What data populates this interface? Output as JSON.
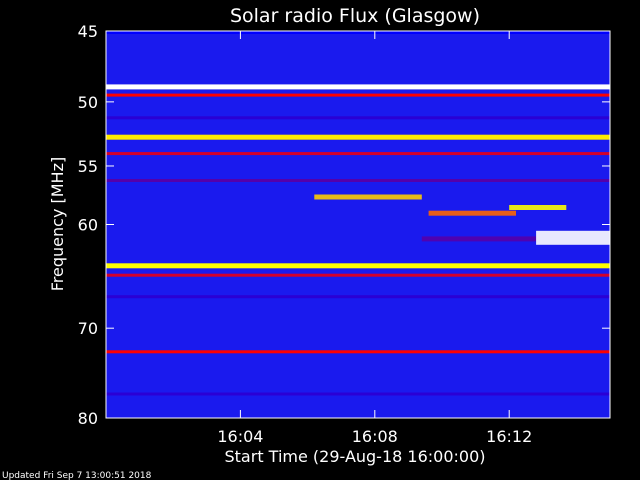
{
  "chart_data": {
    "type": "heatmap",
    "title": "Solar radio Flux (Glasgow)",
    "ylabel": "Frequency [MHz]",
    "xlabel": "Start Time (29-Aug-18 16:00:00)",
    "footer": "Updated Fri Sep  7 13:00:51 2018",
    "x_unit": "minutes after 16:00",
    "xlim": [
      0,
      15
    ],
    "ylim": [
      45,
      80
    ],
    "y_scale": "log",
    "x_ticks": [
      {
        "value": 4,
        "label": "16:04"
      },
      {
        "value": 8,
        "label": "16:08"
      },
      {
        "value": 12,
        "label": "16:12"
      }
    ],
    "y_ticks": [
      {
        "value": 45,
        "label": "45"
      },
      {
        "value": 50,
        "label": "50"
      },
      {
        "value": 55,
        "label": "55"
      },
      {
        "value": 60,
        "label": "60"
      },
      {
        "value": 70,
        "label": "70"
      },
      {
        "value": 80,
        "label": "80"
      }
    ],
    "colormap": [
      "#000080",
      "#0000ff",
      "#ff0000",
      "#ffff00",
      "#ffffff"
    ],
    "background_color": "#1a1aee",
    "continuous_bands": [
      {
        "mhz": 45.1,
        "intensity": 0.25
      },
      {
        "mhz": 48.9,
        "intensity": 1.0
      },
      {
        "mhz": 49.5,
        "intensity": 0.55
      },
      {
        "mhz": 51.2,
        "intensity": 0.3
      },
      {
        "mhz": 52.7,
        "intensity": 0.78
      },
      {
        "mhz": 54.0,
        "intensity": 0.5
      },
      {
        "mhz": 56.2,
        "intensity": 0.35
      },
      {
        "mhz": 63.8,
        "intensity": 0.8
      },
      {
        "mhz": 64.7,
        "intensity": 0.5
      },
      {
        "mhz": 66.8,
        "intensity": 0.3
      },
      {
        "mhz": 72.5,
        "intensity": 0.55
      },
      {
        "mhz": 77.2,
        "intensity": 0.3
      }
    ],
    "burst_features": [
      {
        "t_start": 6.2,
        "t_end": 9.4,
        "mhz": 57.6,
        "intensity": 0.75
      },
      {
        "t_start": 9.6,
        "t_end": 12.2,
        "mhz": 59.0,
        "intensity": 0.65
      },
      {
        "t_start": 12.0,
        "t_end": 13.7,
        "mhz": 58.5,
        "intensity": 0.8
      },
      {
        "t_start": 9.4,
        "t_end": 12.8,
        "mhz": 61.3,
        "intensity": 0.35
      },
      {
        "t_start": 12.8,
        "t_end": 15.0,
        "mhz": 61.2,
        "intensity": 1.0
      }
    ],
    "grid": false
  }
}
